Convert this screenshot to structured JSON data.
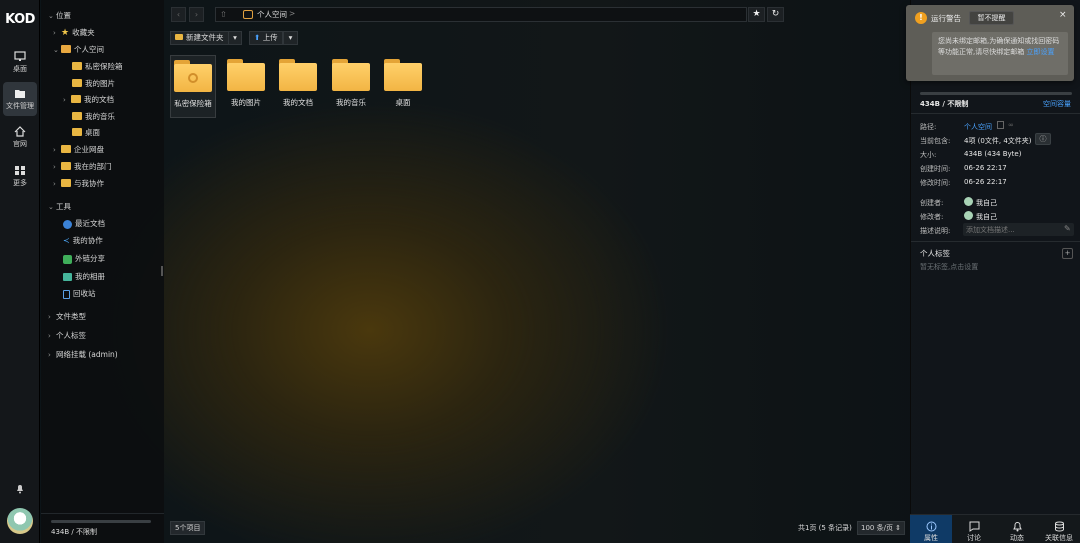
{
  "app": {
    "logo": "KOD"
  },
  "rail": {
    "items": [
      {
        "label": "桌面",
        "icon": "desktop-icon"
      },
      {
        "label": "文件管理",
        "icon": "folder-icon"
      },
      {
        "label": "官网",
        "icon": "home-icon"
      },
      {
        "label": "更多",
        "icon": "grid-icon"
      }
    ]
  },
  "tree": {
    "location_label": "位置",
    "items": [
      {
        "label": "收藏夹"
      },
      {
        "label": "个人空间"
      },
      {
        "label": "私密保险箱"
      },
      {
        "label": "我的图片"
      },
      {
        "label": "我的文档"
      },
      {
        "label": "我的音乐"
      },
      {
        "label": "桌面"
      },
      {
        "label": "企业网盘"
      },
      {
        "label": "我在的部门"
      },
      {
        "label": "与我协作"
      }
    ],
    "tools_label": "工具",
    "tools": [
      {
        "label": "最近文档"
      },
      {
        "label": "我的协作"
      },
      {
        "label": "外链分享"
      },
      {
        "label": "我的相册"
      },
      {
        "label": "回收站"
      }
    ],
    "sections": [
      {
        "label": "文件类型"
      },
      {
        "label": "个人标签"
      },
      {
        "label": "网络挂载 (admin)"
      }
    ],
    "quota": "434B / 不限制"
  },
  "toolbar": {
    "path": "个人空间",
    "path_sep": ">",
    "new_folder": "新建文件夹",
    "upload": "上传"
  },
  "files": [
    {
      "name": "私密保险箱",
      "selected": true
    },
    {
      "name": "我的图片"
    },
    {
      "name": "我的文档"
    },
    {
      "name": "我的音乐"
    },
    {
      "name": "桌面"
    }
  ],
  "status": {
    "count": "5个项目",
    "pages": "共1页 (5 条记录)",
    "per_page": "100 条/页"
  },
  "alert": {
    "title": "运行警告",
    "dismiss": "暂不提醒",
    "message": "您尚未绑定邮箱,为确保通知或找回密码等功能正常,请尽快绑定邮箱",
    "link": "立即设置"
  },
  "panel": {
    "quota": "434B / 不限制",
    "quota_link": "空间容量",
    "path_label": "路径:",
    "path_value": "个人空间",
    "contains_label": "当前包含:",
    "contains_value": "4项 (0文件, 4文件夹)",
    "size_label": "大小:",
    "size_value": "434B (434 Byte)",
    "created_label": "创建时间:",
    "created_value": "06-26 22:17",
    "modified_label": "修改时间:",
    "modified_value": "06-26 22:17",
    "creator_label": "创建者:",
    "creator_value": "我自己",
    "modifier_label": "修改者:",
    "modifier_value": "我自己",
    "desc_label": "描述说明:",
    "desc_placeholder": "添加文档描述...",
    "tags_title": "个人标签",
    "tags_hint": "暂无标签,点击设置"
  },
  "tabs": [
    {
      "label": "属性",
      "active": true
    },
    {
      "label": "讨论"
    },
    {
      "label": "动态"
    },
    {
      "label": "关联信息"
    }
  ]
}
